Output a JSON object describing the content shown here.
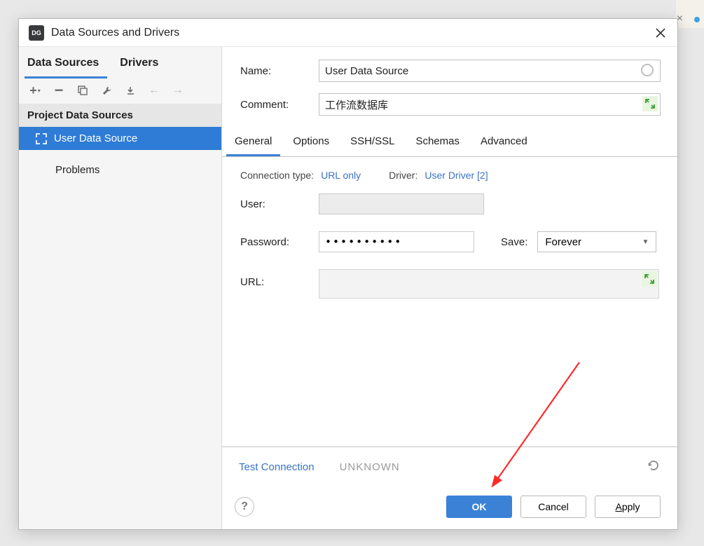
{
  "dialog": {
    "title": "Data Sources and Drivers"
  },
  "sidebar": {
    "tabs": [
      {
        "label": "Data Sources",
        "active": true
      },
      {
        "label": "Drivers",
        "active": false
      }
    ],
    "section_header": "Project Data Sources",
    "items": [
      {
        "label": "User Data Source",
        "selected": true
      }
    ],
    "problems_label": "Problems"
  },
  "form": {
    "name_label": "Name:",
    "name_value": "User Data Source",
    "comment_label": "Comment:",
    "comment_value": "工作流数据库"
  },
  "detail_tabs": [
    {
      "label": "General",
      "active": true
    },
    {
      "label": "Options"
    },
    {
      "label": "SSH/SSL"
    },
    {
      "label": "Schemas"
    },
    {
      "label": "Advanced"
    }
  ],
  "connection": {
    "type_label": "Connection type:",
    "type_value": "URL only",
    "driver_label": "Driver:",
    "driver_value": "User Driver [2]",
    "user_label": "User:",
    "user_value": "",
    "password_label": "Password:",
    "password_value": "••••••••••",
    "save_label": "Save:",
    "save_value": "Forever",
    "url_label": "URL:",
    "url_value": ""
  },
  "footer": {
    "test_label": "Test Connection",
    "status": "UNKNOWN"
  },
  "buttons": {
    "ok": "OK",
    "cancel": "Cancel",
    "apply": "Apply"
  }
}
